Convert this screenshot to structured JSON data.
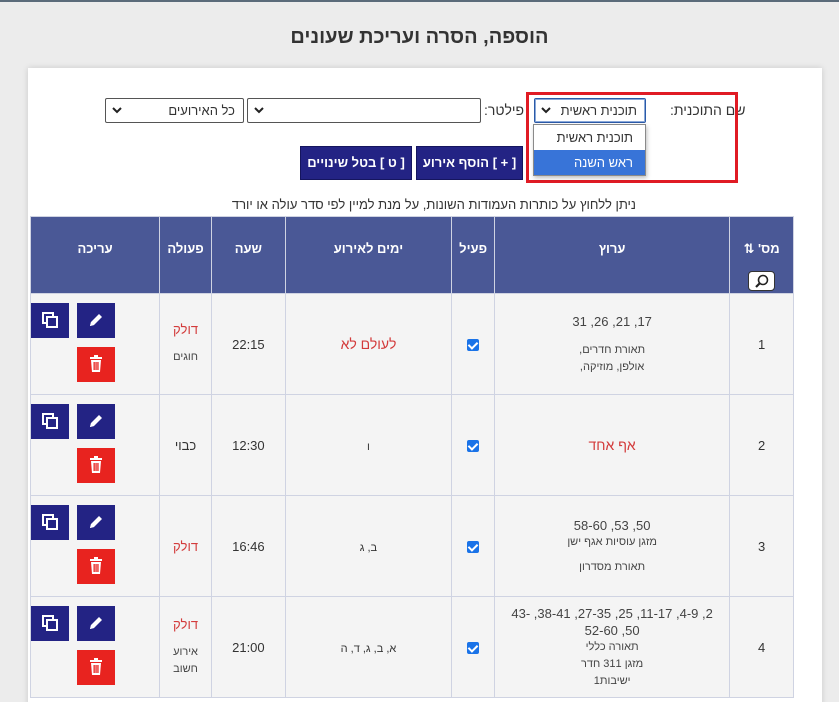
{
  "page": {
    "title": "הוספה, הסרה ועריכת שעונים"
  },
  "filters": {
    "program_label": "שם התוכנית:",
    "program_value": "תוכנית ראשית",
    "program_options": [
      "תוכנית ראשית",
      "ראש השנה"
    ],
    "program_selected_index": 1,
    "filter_label": "פילטר:",
    "filter_value": "",
    "events_value": "כל האירועים"
  },
  "actions": {
    "add_event": "[ + ] הוסף אירוע",
    "cancel_changes": "[ ט ] בטל שינויים"
  },
  "hint": "ניתן ללחוץ על כותרות העמודות השונות, על מנת למיין לפי סדר עולה או יורד",
  "table": {
    "headers": {
      "num": "מס'",
      "sort_icon": "⇅",
      "area": "ערוץ",
      "active": "פעיל",
      "days": "ימים לאירוע",
      "time": "שעה",
      "action": "פעולה",
      "edit": "עריכה"
    },
    "rows": [
      {
        "num": "1",
        "area_nums": "17, 21, 26, 31",
        "area_desc": [
          "תאורת חדרים,",
          "אולפן, מוזיקה,"
        ],
        "active": true,
        "days": "לעולם לא",
        "days_red": true,
        "time": "22:15",
        "action": "דולק",
        "action_red": true,
        "action_sub": "חוגים"
      },
      {
        "num": "2",
        "area_nums": "",
        "area_desc": [],
        "area_red": "אף אחד",
        "active": true,
        "days": "ו",
        "days_red": false,
        "time": "12:30",
        "action": "כבוי",
        "action_red": false,
        "action_sub": ""
      },
      {
        "num": "3",
        "area_nums": "50, 53, 58-60",
        "area_desc": [
          "מזגן עוסיות אגף ישן",
          "",
          "תאורת מסדרון"
        ],
        "active": true,
        "days": "ב, ג",
        "days_red": false,
        "time": "16:46",
        "action": "דולק",
        "action_red": true,
        "action_sub": ""
      },
      {
        "num": "4",
        "area_nums": "2, 4-9, 11-17, 25, 27-35, 38-41, 43-50, 52-60",
        "area_desc": [
          "תאורה כללי",
          "מזגן 311 חדר",
          "ישיבות1"
        ],
        "active": true,
        "days": "א, ב, ג, ד, ה",
        "days_red": false,
        "time": "21:00",
        "action": "דולק",
        "action_red": true,
        "action_sub": "אירוע חשוב"
      }
    ]
  },
  "colors": {
    "navy": "#232384",
    "header_bg": "#4a5896",
    "danger": "#e8231f",
    "highlight_box": "#e01b24",
    "option_selected": "#3874d8"
  }
}
